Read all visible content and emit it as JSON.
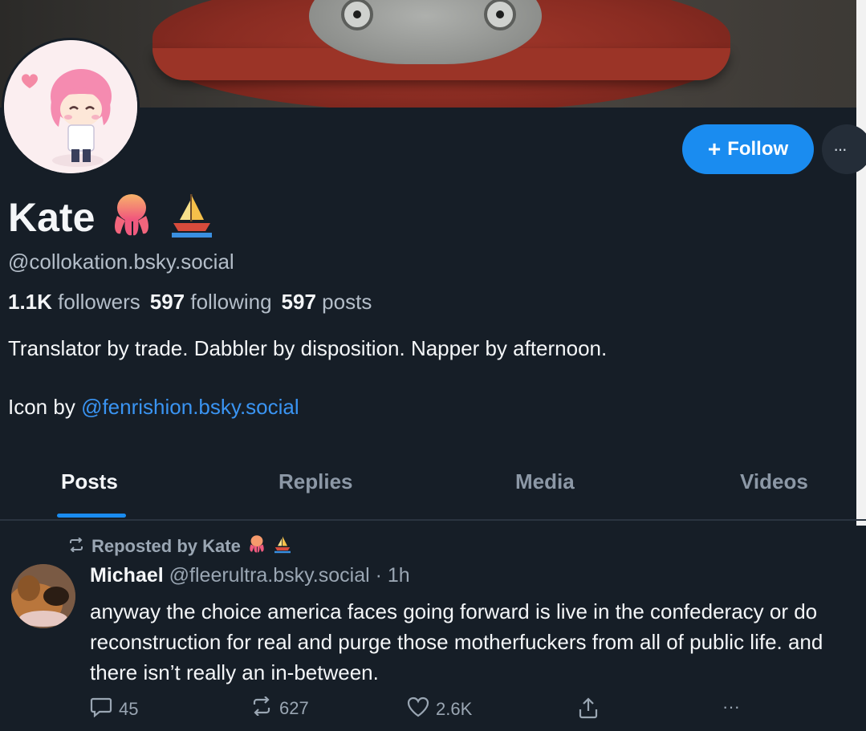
{
  "profile": {
    "display_name": "Kate",
    "handle": "@collokation.bsky.social",
    "followers_count": "1.1K",
    "followers_label": "followers",
    "following_count": "597",
    "following_label": "following",
    "posts_count": "597",
    "posts_label": "posts",
    "bio": "Translator by trade. Dabbler by disposition. Napper by afternoon.",
    "credit_prefix": "Icon by",
    "credit_link": "@fenrishion.bsky.social",
    "name_emoji": [
      "octopus-emoji",
      "sailboat-emoji"
    ]
  },
  "header": {
    "follow_label": "Follow",
    "more_label": "···"
  },
  "tabs": [
    {
      "label": "Posts",
      "active": true
    },
    {
      "label": "Replies",
      "active": false
    },
    {
      "label": "Media",
      "active": false
    },
    {
      "label": "Videos",
      "active": false
    }
  ],
  "post": {
    "repost_label": "Reposted by Kate",
    "author": "Michael",
    "author_handle": "@fleerultra.bsky.social",
    "separator": "·",
    "time": "1h",
    "text": "anyway the choice america faces going forward is live in the confederacy or do reconstruction for real and purge those motherfuckers from all of public life. and there isn’t really an in-between.",
    "replies": "45",
    "reposts": "627",
    "likes": "2.6K"
  },
  "colors": {
    "background": "#161e27",
    "accent": "#1a8cf0",
    "link": "#3a94f2",
    "muted_text": "#9aa6b3"
  }
}
